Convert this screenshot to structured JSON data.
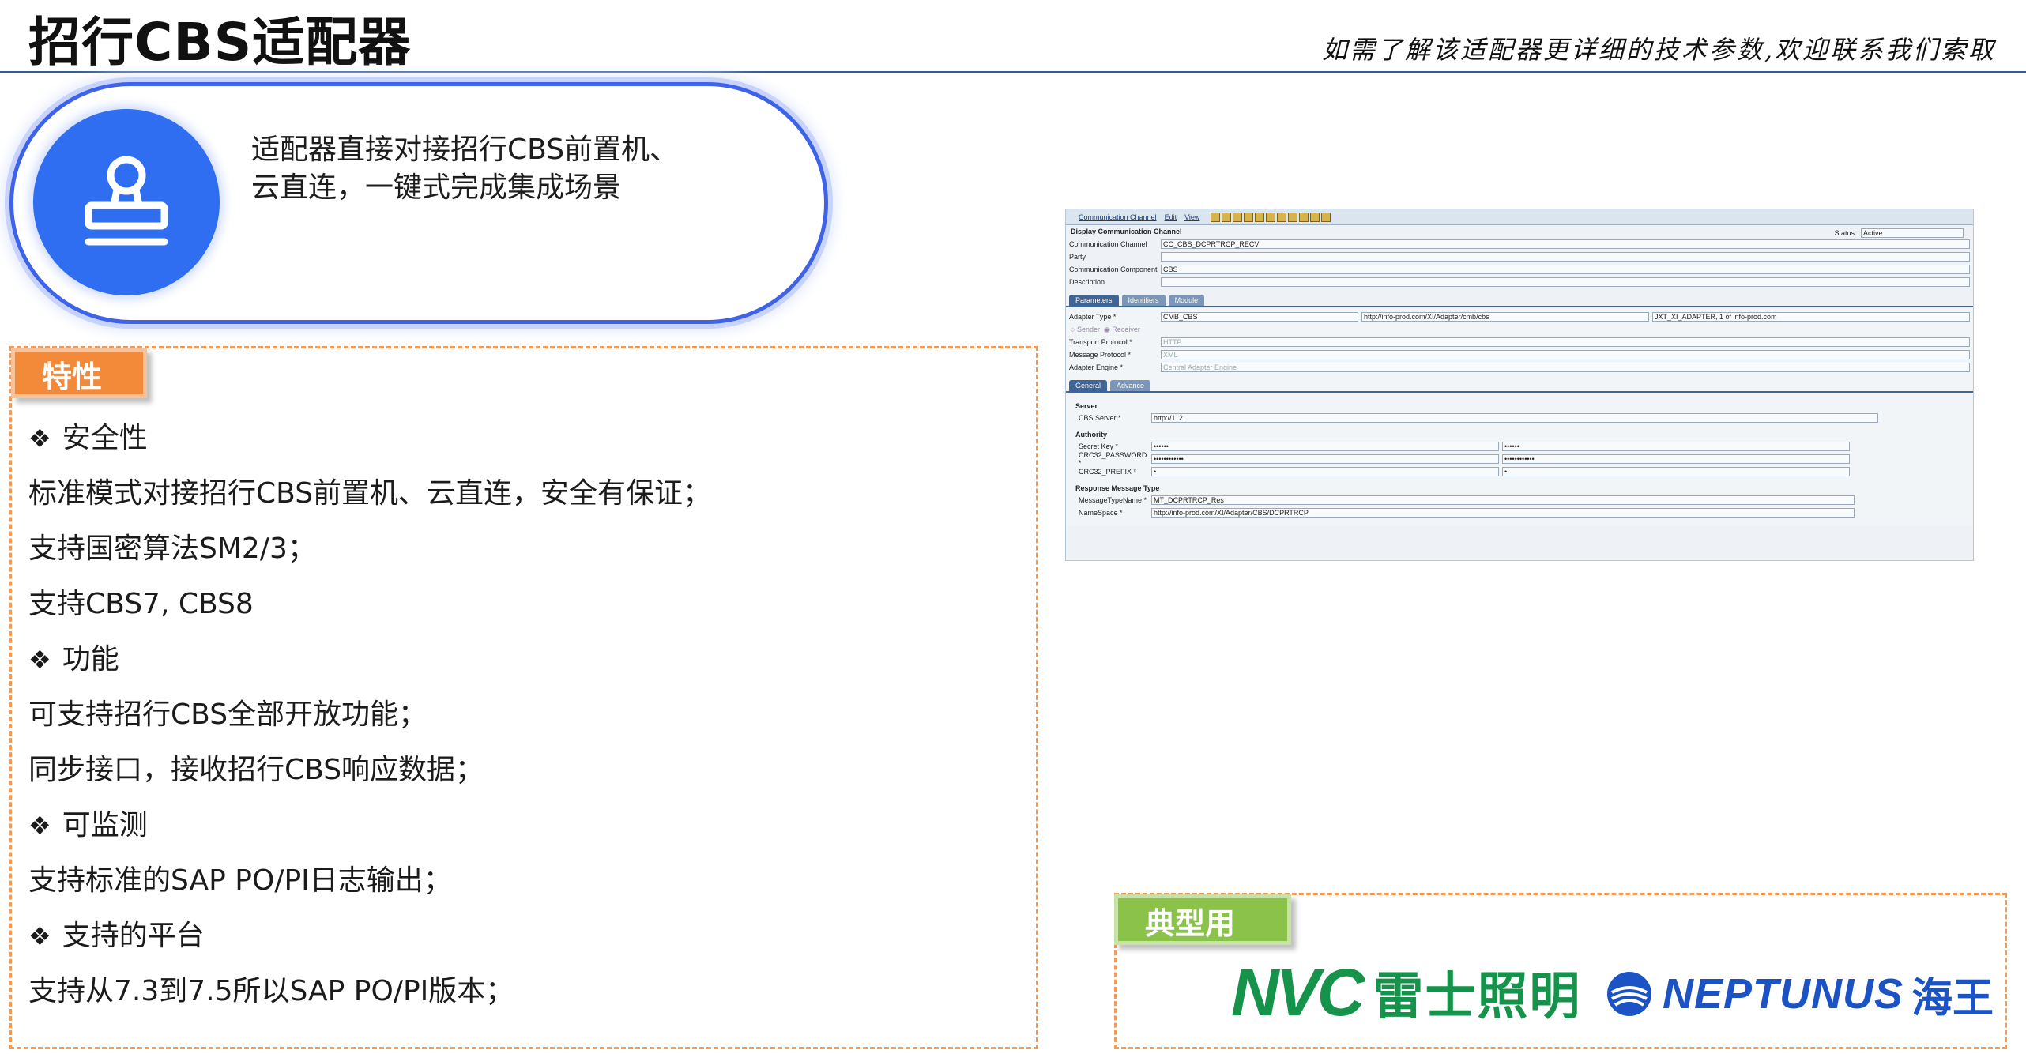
{
  "header": {
    "title": "招行CBS适配器",
    "subtitle": "如需了解该适配器更详细的技术参数,欢迎联系我们索取"
  },
  "intro": {
    "icon": "stamp-icon",
    "lines": [
      "适配器直接对接招行CBS前置机、",
      "云直连，一键式完成集成场景"
    ]
  },
  "features": {
    "tag": "特性",
    "lines": [
      {
        "text": "安全性",
        "head": true
      },
      {
        "text": "标准模式对接招行CBS前置机、云直连，安全有保证；",
        "head": false
      },
      {
        "text": "支持国密算法SM2/3；",
        "head": false
      },
      {
        "text": "支持CBS7, CBS8",
        "head": false
      },
      {
        "text": "功能",
        "head": true
      },
      {
        "text": "可支持招行CBS全部开放功能；",
        "head": false
      },
      {
        "text": "同步接口，接收招行CBS响应数据；",
        "head": false
      },
      {
        "text": "可监测",
        "head": true
      },
      {
        "text": "支持标准的SAP PO/PI日志输出；",
        "head": false
      },
      {
        "text": "支持的平台",
        "head": true
      },
      {
        "text": "支持从7.3到7.5所以SAP PO/PI版本；",
        "head": false
      }
    ]
  },
  "users": {
    "tag": "典型用户",
    "nvc_mark": "NVC",
    "nvc_cn": "雷士照明",
    "neptunus": "NEPTUNUS",
    "neptunus_cn": "海王"
  },
  "sap": {
    "menu": [
      "Communication Channel",
      "Edit",
      "View"
    ],
    "heading": "Display Communication Channel",
    "status_label": "Status",
    "status_value": "Active",
    "rows": [
      {
        "label": "Communication Channel",
        "value": "CC_CBS_DCPRTRCP_RECV"
      },
      {
        "label": "Party",
        "value": ""
      },
      {
        "label": "Communication Component",
        "value": "CBS"
      },
      {
        "label": "Description",
        "value": ""
      }
    ],
    "tabs": [
      "Parameters",
      "Identifiers",
      "Module"
    ],
    "adapter_type_label": "Adapter Type *",
    "adapter_type_values": [
      "CMB_CBS",
      "http://info-prod.com/XI/Adapter/cmb/cbs",
      "JXT_XI_ADAPTER, 1 of info-prod.com"
    ],
    "radios": [
      "Sender",
      "Receiver"
    ],
    "proto_rows": [
      {
        "label": "Transport Protocol *",
        "value": "HTTP"
      },
      {
        "label": "Message Protocol *",
        "value": "XML"
      },
      {
        "label": "Adapter Engine *",
        "value": "Central Adapter Engine"
      }
    ],
    "subtabs": [
      "General",
      "Advance"
    ],
    "server_title": "Server",
    "server_label": "CBS Server *",
    "server_value": "http://112.",
    "authority_title": "Authority",
    "auth_rows": [
      {
        "label": "Secret Key *",
        "value": "••••••",
        "value2": "••••••"
      },
      {
        "label": "CRC32_PASSWORD *",
        "value": "••••••••••••",
        "value2": "••••••••••••"
      },
      {
        "label": "CRC32_PREFIX *",
        "value": "•",
        "value2": "•"
      }
    ],
    "resp_title": "Response Message Type",
    "resp_rows": [
      {
        "label": "MessageTypeName *",
        "value": "MT_DCPRTRCP_Res"
      },
      {
        "label": "NameSpace *",
        "value": "http://info-prod.com/XI/Adapter/CBS/DCPRTRCP"
      }
    ]
  }
}
